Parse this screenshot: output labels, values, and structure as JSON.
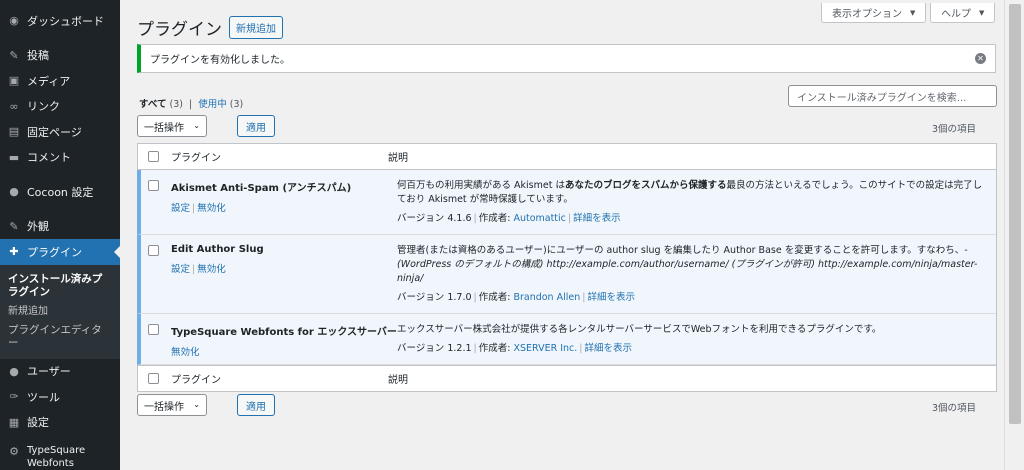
{
  "sidebar": {
    "items": [
      {
        "icon": "dashboard-icon",
        "glyph": "◉",
        "label": "ダッシュボード"
      },
      {
        "icon": "pin-icon",
        "glyph": "✎",
        "label": "投稿"
      },
      {
        "icon": "media-icon",
        "glyph": "▣",
        "label": "メディア"
      },
      {
        "icon": "link-icon",
        "glyph": "∞",
        "label": "リンク"
      },
      {
        "icon": "page-icon",
        "glyph": "▤",
        "label": "固定ページ"
      },
      {
        "icon": "comment-icon",
        "glyph": "▬",
        "label": "コメント"
      },
      {
        "icon": "cocoon-icon",
        "glyph": "●",
        "label": "Cocoon 設定"
      },
      {
        "icon": "appearance-icon",
        "glyph": "✎",
        "label": "外観"
      },
      {
        "icon": "plugin-icon",
        "glyph": "✚",
        "label": "プラグイン"
      },
      {
        "icon": "user-icon",
        "glyph": "●",
        "label": "ユーザー"
      },
      {
        "icon": "tool-icon",
        "glyph": "✑",
        "label": "ツール"
      },
      {
        "icon": "settings-icon",
        "glyph": "▦",
        "label": "設定"
      },
      {
        "icon": "gear-icon",
        "glyph": "⚙",
        "label": "TypeSquare Webfonts"
      }
    ],
    "submenu": [
      "インストール済みプラグイン",
      "新規追加",
      "プラグインエディター"
    ]
  },
  "header": {
    "screen_options": "表示オプション",
    "help": "ヘルプ",
    "title": "プラグイン",
    "add_new": "新規追加"
  },
  "notice": {
    "text": "プラグインを有効化しました。"
  },
  "filters": {
    "all_label": "すべて",
    "all_count": "(3)",
    "separator": "|",
    "active_label": "使用中",
    "active_count": "(3)"
  },
  "search": {
    "placeholder": "インストール済みプラグインを検索..."
  },
  "bulk": {
    "label": "一括操作",
    "apply": "適用",
    "count": "3個の項目"
  },
  "table": {
    "col_plugin": "プラグイン",
    "col_desc": "説明",
    "rows": [
      {
        "name": "Akismet Anti-Spam (アンチスパム)",
        "settings": "設定",
        "deactivate": "無効化",
        "desc_pre": "何百万もの利用実績がある Akismet は",
        "desc_bold": "あなたのブログをスパムから保護する",
        "desc_post": "最良の方法といえるでしょう。このサイトでの設定は完了しており Akismet が常時保護しています。",
        "version": "バージョン 4.1.6",
        "author_label": "作成者:",
        "author": "Automattic",
        "details": "詳細を表示"
      },
      {
        "name": "Edit Author Slug",
        "settings": "設定",
        "deactivate": "無効化",
        "desc_pre": "管理者(または資格のあるユーザー)にユーザーの author slug を編集したり Author Base を変更することを許可します。すなわち、-",
        "desc_italic1": "(WordPress のデフォルトの構成)",
        "desc_italic2": "http://example.com/author/username/",
        "desc_mid": "(プラグインが許可)",
        "desc_italic3": "http://example.com/ninja/master-ninja/",
        "version": "バージョン 1.7.0",
        "author_label": "作成者:",
        "author": "Brandon Allen",
        "details": "詳細を表示"
      },
      {
        "name": "TypeSquare Webfonts for エックスサーバー",
        "deactivate": "無効化",
        "desc": "エックスサーバー株式会社が提供する各レンタルサーバーサービスでWebフォントを利用できるプラグインです。",
        "version": "バージョン 1.2.1",
        "author_label": "作成者:",
        "author": "XSERVER Inc.",
        "details": "詳細を表示"
      }
    ]
  },
  "colors": {
    "accent": "#2271b1",
    "sidebar_bg": "#1d2327",
    "notice": "#00a32a",
    "active_row": "#f0f6fc"
  }
}
